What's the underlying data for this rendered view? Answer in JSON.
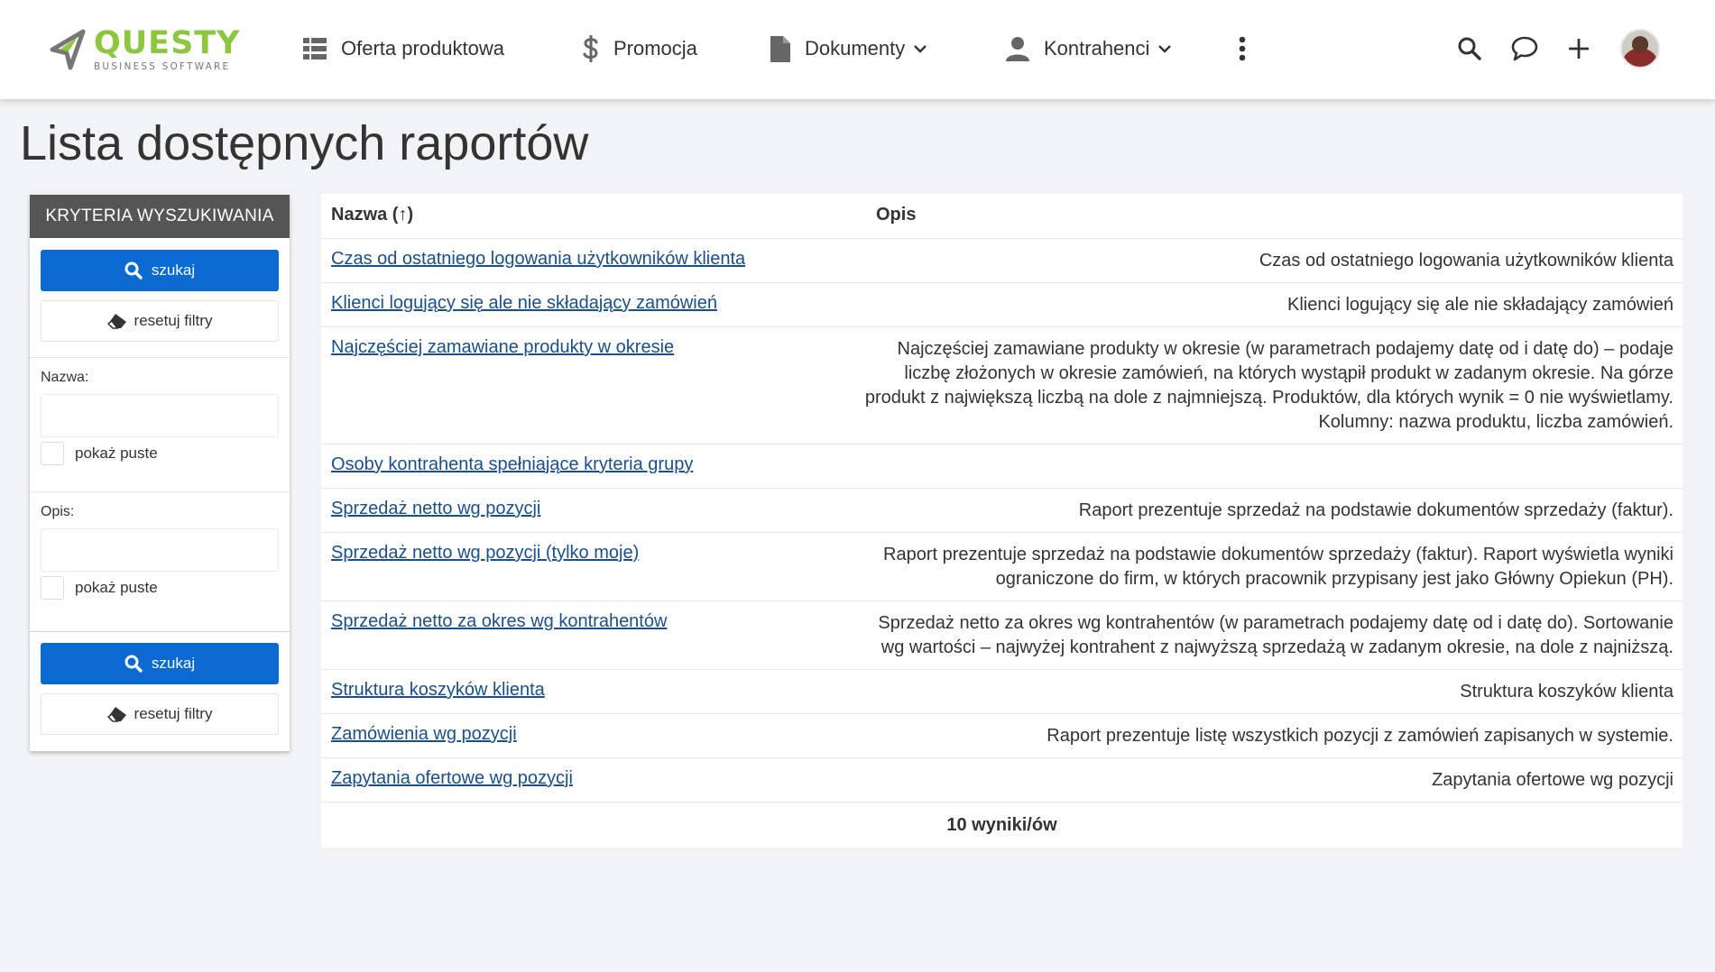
{
  "brand": {
    "name": "QUESTY",
    "tagline": "BUSINESS SOFTWARE",
    "accent": "#8dc63f"
  },
  "nav": {
    "oferta": "Oferta produktowa",
    "promocja": "Promocja",
    "dokumenty": "Dokumenty",
    "kontrahenci": "Kontrahenci"
  },
  "header_icons": [
    "grid-icon",
    "dollar-icon",
    "document-icon",
    "user-icon",
    "kebab-menu-icon",
    "search-icon",
    "chat-icon",
    "plus-icon"
  ],
  "page": {
    "title": "Lista dostępnych raportów"
  },
  "sidebar": {
    "title": "KRYTERIA WYSZUKIWANIA",
    "search_label": "szukaj",
    "reset_label": "resetuj filtry",
    "name_label": "Nazwa:",
    "name_value": "",
    "desc_label": "Opis:",
    "desc_value": "",
    "show_empty_label": "pokaż puste"
  },
  "table": {
    "col_name": "Nazwa (↑)",
    "col_desc": "Opis",
    "rows": [
      {
        "name": "Czas od ostatniego logowania użytkowników klienta",
        "desc": "Czas od ostatniego logowania użytkowników klienta"
      },
      {
        "name": "Klienci logujący się ale nie składający zamówień",
        "desc": "Klienci logujący się ale nie składający zamówień"
      },
      {
        "name": "Najczęściej zamawiane produkty w okresie",
        "desc": "Najczęściej zamawiane produkty w okresie (w parametrach podajemy datę od i datę do) – podaje liczbę złożonych w okresie zamówień, na których wystąpił produkt w zadanym okresie. Na górze produkt z największą liczbą na dole z najmniejszą. Produktów, dla których wynik = 0 nie wyświetlamy. Kolumny: nazwa produktu, liczba zamówień."
      },
      {
        "name": "Osoby kontrahenta spełniające kryteria grupy",
        "desc": ""
      },
      {
        "name": "Sprzedaż netto wg pozycji",
        "desc": "Raport prezentuje sprzedaż na podstawie dokumentów sprzedaży (faktur)."
      },
      {
        "name": "Sprzedaż netto wg pozycji (tylko moje)",
        "desc": "Raport prezentuje sprzedaż na podstawie dokumentów sprzedaży (faktur). Raport wyświetla wyniki ograniczone do firm, w których pracownik przypisany jest jako Główny Opiekun (PH)."
      },
      {
        "name": "Sprzedaż netto za okres wg kontrahentów",
        "desc": "Sprzedaż netto za okres wg kontrahentów (w parametrach podajemy datę od i datę do). Sortowanie wg wartości – najwyżej kontrahent z najwyższą sprzedażą w zadanym okresie, na dole z najniższą."
      },
      {
        "name": "Struktura koszyków klienta",
        "desc": "Struktura koszyków klienta"
      },
      {
        "name": "Zamówienia wg pozycji",
        "desc": "Raport prezentuje listę wszystkich pozycji z zamówień zapisanych w systemie."
      },
      {
        "name": "Zapytania ofertowe wg pozycji",
        "desc": "Zapytania ofertowe wg pozycji"
      }
    ],
    "footer": "10 wyniki/ów"
  },
  "colors": {
    "primary_button": "#0a6ad2",
    "link": "#1a4f8a",
    "sidebar_header": "#555555"
  }
}
